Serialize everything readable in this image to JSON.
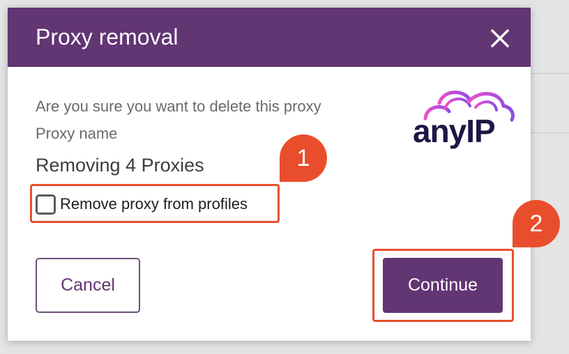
{
  "dialog": {
    "title": "Proxy removal",
    "close_icon": "close-icon",
    "prompt": "Are you sure you want to delete this proxy",
    "field_label": "Proxy name",
    "field_value": "Removing 4 Proxies",
    "logo_text": "anyIP",
    "checkbox": {
      "label": "Remove proxy from profiles",
      "checked": false
    },
    "cancel_label": "Cancel",
    "continue_label": "Continue"
  },
  "annotations": {
    "marker_1": "1",
    "marker_2": "2"
  },
  "colors": {
    "header": "#623573",
    "accent": "#e94e2c",
    "logo_text": "#1b1845"
  }
}
